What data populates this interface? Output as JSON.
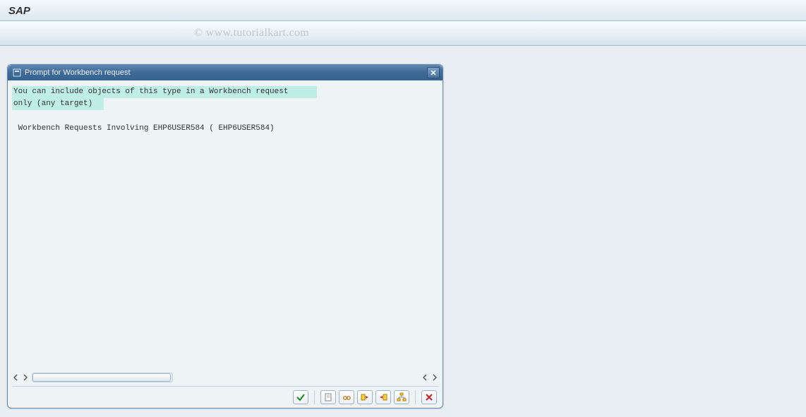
{
  "header": {
    "title": "SAP"
  },
  "watermark": "© www.tutorialkart.com",
  "dialog": {
    "title": "Prompt for Workbench request",
    "info_line1": "You can include objects of this type in a Workbench request",
    "info_line2": "only (any target)",
    "requests_line": " Workbench Requests Involving EHP6USER584 ( EHP6USER584)"
  }
}
